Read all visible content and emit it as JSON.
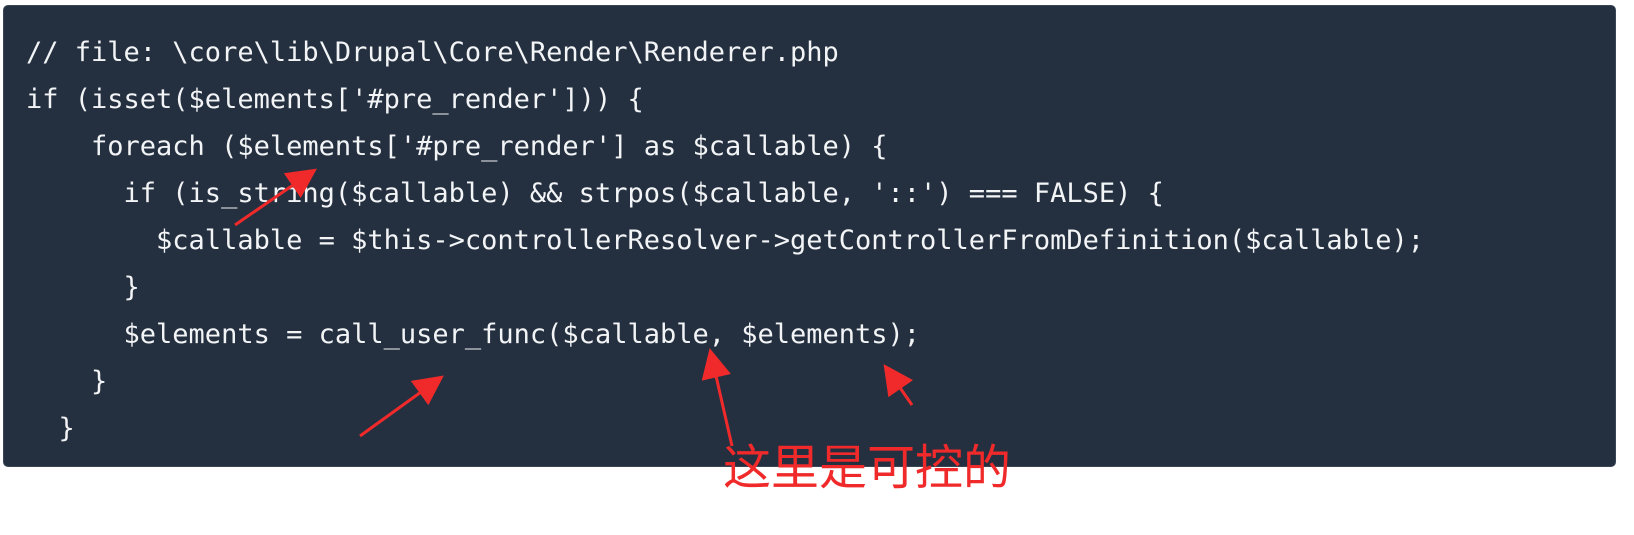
{
  "code": {
    "lines": [
      "// file: \\core\\lib\\Drupal\\Core\\Render\\Renderer.php",
      "if (isset($elements['#pre_render'])) {",
      "    foreach ($elements['#pre_render'] as $callable) {",
      "      if (is_string($callable) && strpos($callable, '::') === FALSE) {",
      "        $callable = $this->controllerResolver->getControllerFromDefinition($callable);",
      "      }",
      "      $elements = call_user_func($callable, $elements);",
      "    }",
      "  }"
    ]
  },
  "annotation": {
    "text": "这里是可控的",
    "color": "#f02a2a"
  },
  "theme": {
    "panel_background": "#243040",
    "code_color": "#f2f4f6"
  },
  "arrows": [
    {
      "name": "arrow-to-pre-render-elements"
    },
    {
      "name": "arrow-to-call-user-func"
    },
    {
      "name": "arrow-to-callable-argument"
    },
    {
      "name": "arrow-to-elements-argument"
    }
  ]
}
